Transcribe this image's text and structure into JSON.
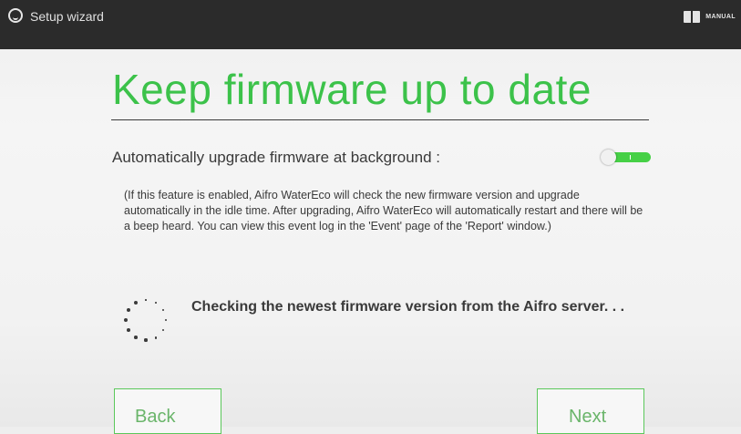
{
  "topbar": {
    "title": "Setup wizard",
    "manual_label": "MANUAL"
  },
  "page": {
    "title": "Keep firmware up to date",
    "option_label": "Automatically upgrade firmware at background :",
    "toggle_state": "on",
    "description": "(If this feature is enabled, Aifro WaterEco will check the new firmware version and upgrade automatically in the idle time. After upgrading, Aifro WaterEco will automatically restart and there will be a beep heard. You can view this event log in the 'Event' page of the 'Report' window.)",
    "status": "Checking the newest firmware version from the Aifro server. . ."
  },
  "buttons": {
    "back_label": "Back",
    "next_label": "Next"
  },
  "colors": {
    "accent": "#3cc24a",
    "toggle_on": "#46d046",
    "topbar_bg": "#2b2b2b",
    "button_border": "#5bc85b"
  },
  "icons": [
    "app-logo-icon",
    "book-icon",
    "loading-spinner-icon"
  ]
}
